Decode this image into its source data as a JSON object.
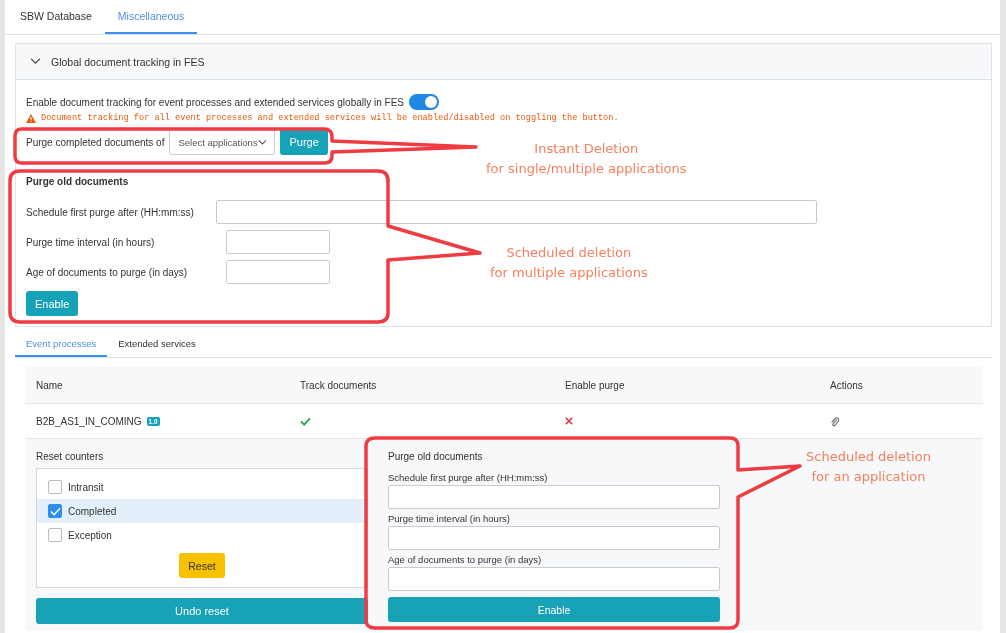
{
  "tabs": [
    {
      "label": "SBW Database",
      "selected": false
    },
    {
      "label": "Miscellaneous",
      "selected": true
    }
  ],
  "global_panel": {
    "title": "Global document tracking in FES",
    "expanded": true,
    "tracking_toggle": {
      "label": "Enable document tracking for event processes and extended services globally in FES",
      "on": true
    },
    "warning": "Document tracking for all event processes and extended services will be enabled/disabled on toggling the button.",
    "purge_row": {
      "label": "Purge completed documents of",
      "select_placeholder": "Select applications",
      "button": "Purge"
    },
    "purge_old": {
      "title": "Purge old documents",
      "fields": [
        {
          "label": "Schedule first purge after (HH:mm:ss)"
        },
        {
          "label": "Purge time interval (in hours)"
        },
        {
          "label": "Age of documents to purge (in days)"
        }
      ],
      "button": "Enable"
    }
  },
  "sub_tabs": [
    {
      "label": "Event processes",
      "selected": true
    },
    {
      "label": "Extended services",
      "selected": false
    }
  ],
  "table": {
    "columns": [
      "Name",
      "Track documents",
      "Enable purge",
      "Actions"
    ],
    "rows": [
      {
        "name": "B2B_AS1_IN_COMING",
        "version": "1.0",
        "track_documents": true,
        "enable_purge": false,
        "expanded": true
      }
    ]
  },
  "reset_counters": {
    "title": "Reset counters",
    "options": [
      {
        "label": "Intransit",
        "checked": false,
        "selected": false
      },
      {
        "label": "Completed",
        "checked": true,
        "selected": true
      },
      {
        "label": "Exception",
        "checked": false,
        "selected": false
      }
    ],
    "reset_button": "Reset",
    "undo_button": "Undo reset"
  },
  "app_purge": {
    "title": "Purge old documents",
    "fields": [
      {
        "label": "Schedule first purge after (HH:mm:ss)"
      },
      {
        "label": "Purge time interval (in hours)"
      },
      {
        "label": "Age of documents to purge (in days)"
      }
    ],
    "button": "Enable"
  },
  "annotations": [
    {
      "lines": [
        "Instant Deletion",
        "for single/multiple applications"
      ]
    },
    {
      "lines": [
        "Scheduled deletion",
        "for multiple applications"
      ]
    },
    {
      "lines": [
        "Scheduled deletion",
        "for an application"
      ]
    }
  ]
}
